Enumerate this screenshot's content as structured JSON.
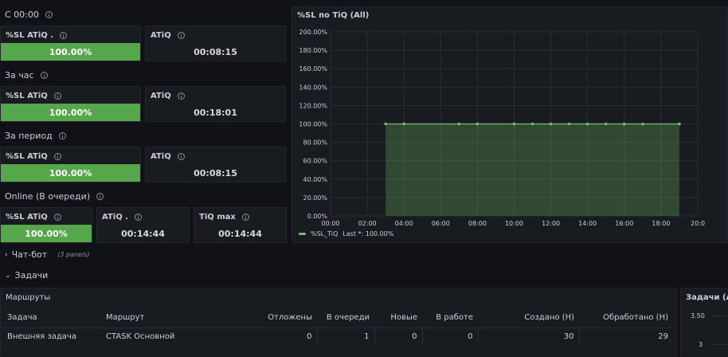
{
  "sections": {
    "since_midnight": "С 00:00",
    "last_hour": "За час",
    "period": "За период",
    "online": "Online (В очереди)"
  },
  "row1": {
    "sl_title": "%SL ATiQ .",
    "sl_value": "100.00%",
    "sl_level": 100,
    "atiq_title": "ATiQ",
    "atiq_value": "00:08:15"
  },
  "row2": {
    "sl_title": "%SL ATiQ",
    "sl_value": "100.00%",
    "sl_level": 100,
    "atiq_title": "ATiQ",
    "atiq_value": "00:18:01"
  },
  "row3": {
    "sl_title": "%SL ATiQ",
    "sl_value": "100.00%",
    "sl_level": 100,
    "atiq_title": "ATiQ",
    "atiq_value": "00:08:15"
  },
  "row4": {
    "sl_title": "%SL ATiQ",
    "sl_value": "100.00%",
    "sl_level": 100,
    "atiq_title": "ATiQ .",
    "atiq_value": "00:14:44",
    "tiqmax_title": "TiQ max",
    "tiqmax_value": "00:14:44"
  },
  "chart_panel": {
    "title": "%SL по TiQ (All)",
    "legend_label": "%SL_TiQ",
    "legend_last": "Last *: 100.00%"
  },
  "chart_data": {
    "type": "area",
    "title": "%SL по TiQ (All)",
    "x_ticks": [
      "00:00",
      "02:00",
      "04:00",
      "06:00",
      "08:00",
      "10:00",
      "12:00",
      "14:00",
      "16:00",
      "18:00",
      "20:0"
    ],
    "y_ticks": [
      "0.00%",
      "20.00%",
      "40.00%",
      "60.00%",
      "80.00%",
      "100.00%",
      "120.00%",
      "140.00%",
      "160.00%",
      "180.00%",
      "200.00%"
    ],
    "ylim": [
      0,
      200
    ],
    "xlim_hours": [
      0,
      20
    ],
    "grid": true,
    "legend_placement": "bottom-left",
    "series": [
      {
        "name": "%SL_TiQ",
        "color": "#73bf69",
        "x_hours": [
          3,
          4,
          7,
          8,
          10,
          11,
          12,
          13,
          14,
          15,
          16,
          17,
          19
        ],
        "y": [
          100,
          100,
          100,
          100,
          100,
          100,
          100,
          100,
          100,
          100,
          100,
          100,
          100
        ]
      }
    ]
  },
  "collapsed_row": {
    "title": "Чат-бот",
    "count": "(3 panels)"
  },
  "tasks_row": {
    "title": "Задачи"
  },
  "routes_table": {
    "title": "Маршруты",
    "headers": [
      "Задача",
      "Маршрут",
      "Отложены",
      "В очереди",
      "Новые",
      "В работе",
      "Создано (Н)",
      "Обработано (Н)"
    ],
    "rows": [
      [
        "Внешняя задача",
        "CTASK Основной",
        "0",
        "1",
        "0",
        "0",
        "30",
        "29"
      ]
    ]
  },
  "tasks_panel": {
    "title": "Задачи (All",
    "y_ticks": [
      "3.50",
      "3"
    ]
  },
  "colors": {
    "background": "#111217",
    "panel": "#181b1f",
    "green": "#56a64b",
    "series_green": "#73bf69"
  }
}
